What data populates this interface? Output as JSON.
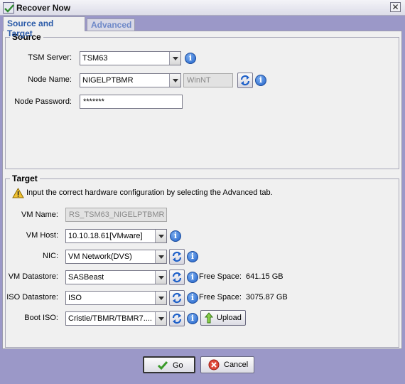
{
  "window": {
    "title": "Recover Now",
    "close_glyph": "✕"
  },
  "tabs": [
    {
      "label": "Source and Target",
      "active": true
    },
    {
      "label": "Advanced",
      "active": false
    }
  ],
  "source": {
    "title": "Source",
    "tsm_server": {
      "label": "TSM Server:",
      "value": "TSM63"
    },
    "node_name": {
      "label": "Node Name:",
      "value": "NIGELPTBMR",
      "os_value": "WinNT"
    },
    "node_password": {
      "label": "Node Password:",
      "value": "*******"
    }
  },
  "target": {
    "title": "Target",
    "warning": "Input the correct hardware configuration by selecting the Advanced tab.",
    "vm_name": {
      "label": "VM Name:",
      "value": "RS_TSM63_NIGELPTBMR"
    },
    "vm_host": {
      "label": "VM Host:",
      "value": "10.10.18.61[VMware]"
    },
    "nic": {
      "label": "NIC:",
      "value": "VM Network(DVS)"
    },
    "vm_datastore": {
      "label": "VM Datastore:",
      "value": "SASBeast",
      "free_label": "Free Space:",
      "free_value": "641.15 GB"
    },
    "iso_datastore": {
      "label": "ISO Datastore:",
      "value": "ISO",
      "free_label": "Free Space:",
      "free_value": "3075.87 GB"
    },
    "boot_iso": {
      "label": "Boot ISO:",
      "value": "Cristie/TBMR/TBMR7....",
      "upload_label": "Upload"
    }
  },
  "footer": {
    "go_label": "Go",
    "cancel_label": "Cancel"
  },
  "icons": {
    "info": "info-icon",
    "refresh": "refresh-icon",
    "warning": "warning-icon",
    "go": "checkmark-icon",
    "cancel": "cancel-icon",
    "upload": "up-arrow-icon"
  },
  "colors": {
    "dialog_background": "#9b98c8",
    "panel_background": "#f0f0f0",
    "active_tab_text": "#2a5aa8",
    "info_blue": "#1d5fc8"
  }
}
